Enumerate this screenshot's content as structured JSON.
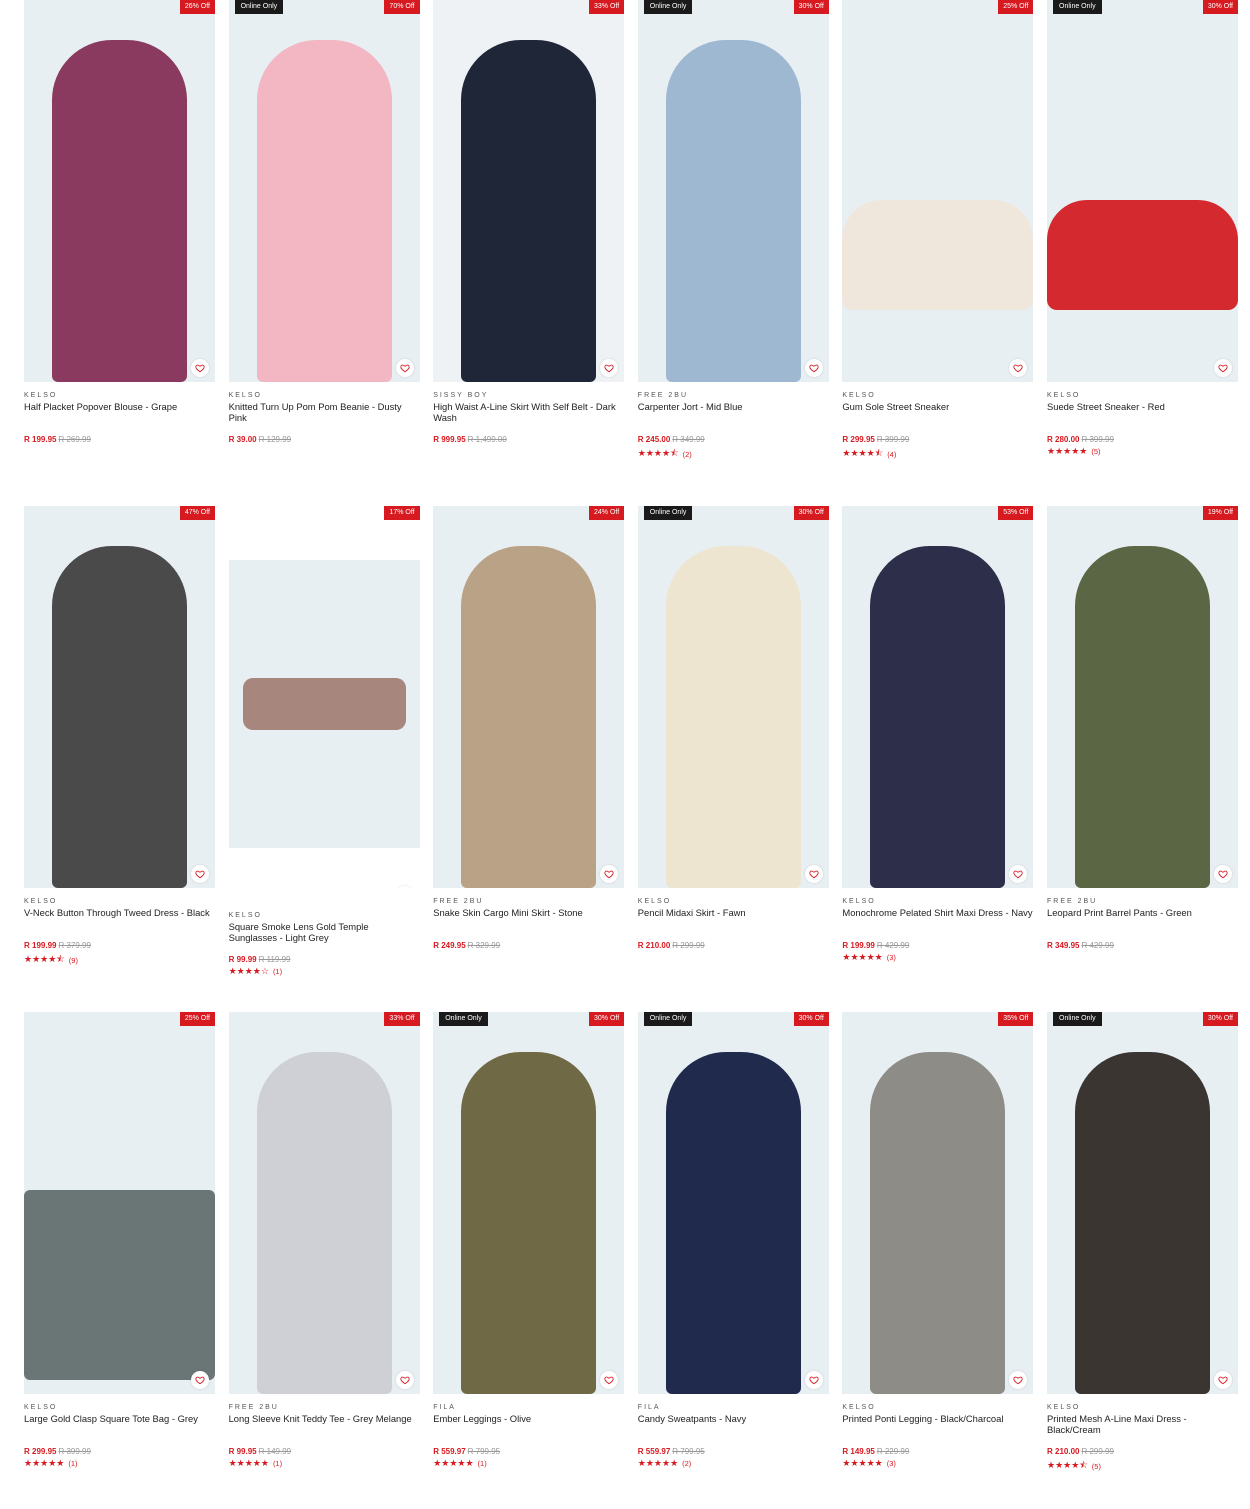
{
  "favorite_icon": "heart-outline-icon",
  "colors": {
    "sale_red": "#d71920",
    "online_badge_bg": "#1a1a1a",
    "price_red": "#d71920"
  },
  "products": [
    [
      {
        "brand": "KELSO",
        "name": "Half Placket Popover Blouse - Grape",
        "price": "R 199.95",
        "was": "R 269.99",
        "discount": "26% Off",
        "online": "",
        "rating": "",
        "stars": 0,
        "bg": "#e8eff3",
        "color": "#8a3a5f"
      },
      {
        "brand": "KELSO",
        "name": "Knitted Turn Up Pom Pom Beanie - Dusty Pink",
        "price": "R 39.00",
        "was": "R 129.99",
        "discount": "70% Off",
        "online": "Online Only",
        "rating": "",
        "stars": 0,
        "bg": "#e8eff3",
        "color": "#f2b7c2"
      },
      {
        "brand": "SISSY BOY",
        "name": "High Waist A-Line Skirt With Self Belt - Dark Wash",
        "price": "R 999.95",
        "was": "R 1,499.00",
        "discount": "33% Off",
        "online": "",
        "rating": "",
        "stars": 0,
        "bg": "#eef2f4",
        "color": "#1e2638"
      },
      {
        "brand": "FREE 2BU",
        "name": "Carpenter Jort - Mid Blue",
        "price": "R 245.00",
        "was": "R 349.99",
        "discount": "30% Off",
        "online": "Online Only",
        "rating": "(2)",
        "stars": 4.5,
        "bg": "#e8eff3",
        "color": "#9fb8d2"
      },
      {
        "brand": "KELSO",
        "name": "Gum Sole Street Sneaker",
        "price": "R 299.95",
        "was": "R 399.99",
        "discount": "25% Off",
        "online": "",
        "rating": "(4)",
        "stars": 4.5,
        "bg": "#e8eff3",
        "color": "#efe7dc"
      },
      {
        "brand": "KELSO",
        "name": "Suede Street Sneaker - Red",
        "price": "R 280.00",
        "was": "R 399.99",
        "discount": "30% Off",
        "online": "Online Only",
        "rating": "(5)",
        "stars": 5,
        "bg": "#e8eff3",
        "color": "#d42a2f"
      }
    ],
    [
      {
        "brand": "KELSO",
        "name": "V-Neck Button Through Tweed Dress - Black",
        "price": "R 199.99",
        "was": "R 379.99",
        "discount": "47% Off",
        "online": "",
        "rating": "(9)",
        "stars": 4.5,
        "bg": "#e8eff3",
        "color": "#4a4a4a"
      },
      {
        "brand": "KELSO",
        "name": "Square Smoke Lens Gold Temple Sunglasses - Light Grey",
        "price": "R 99.99",
        "was": "R 119.99",
        "discount": "17% Off",
        "online": "",
        "rating": "(1)",
        "stars": 4,
        "bg": "#e8eff3",
        "color": "#8b5a4a",
        "square": true
      },
      {
        "brand": "FREE 2BU",
        "name": "Snake Skin Cargo Mini Skirt - Stone",
        "price": "R 249.95",
        "was": "R 329.99",
        "discount": "24% Off",
        "online": "",
        "rating": "",
        "stars": 0,
        "bg": "#e8eff3",
        "color": "#b9a286"
      },
      {
        "brand": "KELSO",
        "name": "Pencil Midaxi Skirt - Fawn",
        "price": "R 210.00",
        "was": "R 299.99",
        "discount": "30% Off",
        "online": "Online Only",
        "rating": "",
        "stars": 0,
        "bg": "#e8eff3",
        "color": "#ede5cf"
      },
      {
        "brand": "KELSO",
        "name": "Monochrome Pelated Shirt Maxi Dress - Navy",
        "price": "R 199.99",
        "was": "R 429.99",
        "discount": "53% Off",
        "online": "",
        "rating": "(3)",
        "stars": 5,
        "bg": "#e8eff3",
        "color": "#2c2e4a"
      },
      {
        "brand": "FREE 2BU",
        "name": "Leopard Print Barrel Pants - Green",
        "price": "R 349.95",
        "was": "R 429.99",
        "discount": "19% Off",
        "online": "",
        "rating": "",
        "stars": 0,
        "bg": "#e8eff3",
        "color": "#5a6644"
      }
    ],
    [
      {
        "brand": "KELSO",
        "name": "Large Gold Clasp Square Tote Bag - Grey",
        "price": "R 299.95",
        "was": "R 399.99",
        "discount": "25% Off",
        "online": "",
        "rating": "(1)",
        "stars": 5,
        "bg": "#e8eff3",
        "color": "#6a7576"
      },
      {
        "brand": "FREE 2BU",
        "name": "Long Sleeve Knit Teddy Tee - Grey Melange",
        "price": "R 99.95",
        "was": "R 149.99",
        "discount": "33% Off",
        "online": "",
        "rating": "(1)",
        "stars": 5,
        "bg": "#e8eff3",
        "color": "#cfd0d6"
      },
      {
        "brand": "FILA",
        "name": "Ember Leggings - Olive",
        "price": "R 559.97",
        "was": "R 799.95",
        "discount": "30% Off",
        "online": "Online Only",
        "rating": "(1)",
        "stars": 5,
        "bg": "#e8eff3",
        "color": "#6f6a45"
      },
      {
        "brand": "FILA",
        "name": "Candy Sweatpants - Navy",
        "price": "R 559.97",
        "was": "R 799.95",
        "discount": "30% Off",
        "online": "Online Only",
        "rating": "(2)",
        "stars": 5,
        "bg": "#e8eff3",
        "color": "#1f2a4c"
      },
      {
        "brand": "KELSO",
        "name": "Printed Ponti Legging - Black/Charcoal",
        "price": "R 149.95",
        "was": "R 229.99",
        "discount": "35% Off",
        "online": "",
        "rating": "(3)",
        "stars": 5,
        "bg": "#e8eff3",
        "color": "#8d8c86"
      },
      {
        "brand": "KELSO",
        "name": "Printed Mesh A-Line Maxi Dress - Black/Cream",
        "price": "R 210.00",
        "was": "R 299.99",
        "discount": "30% Off",
        "online": "Online Only",
        "rating": "(5)",
        "stars": 4.5,
        "bg": "#e8eff3",
        "color": "#3a3531"
      }
    ]
  ]
}
